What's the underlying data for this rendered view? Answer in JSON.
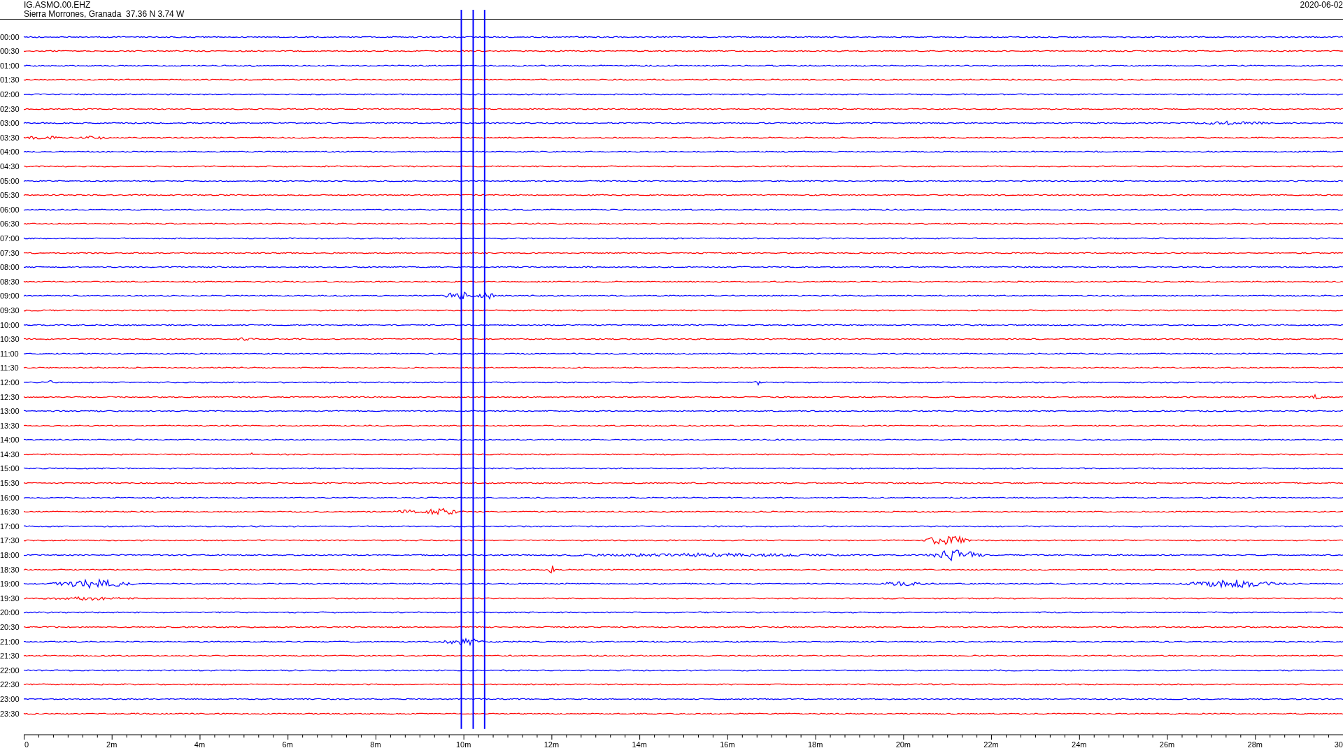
{
  "station": {
    "code": "IG.ASMO.00.EHZ",
    "location": "Sierra Morrones, Granada  37.36 N 3.74 W"
  },
  "date": "2020-06-02",
  "rows": [
    {
      "time": "00:00",
      "color": "#0000ff"
    },
    {
      "time": "00:30",
      "color": "#ff0000"
    },
    {
      "time": "01:00",
      "color": "#0000ff"
    },
    {
      "time": "01:30",
      "color": "#ff0000"
    },
    {
      "time": "02:00",
      "color": "#0000ff"
    },
    {
      "time": "02:30",
      "color": "#ff0000"
    },
    {
      "time": "03:00",
      "color": "#0000ff"
    },
    {
      "time": "03:30",
      "color": "#ff0000"
    },
    {
      "time": "04:00",
      "color": "#0000ff"
    },
    {
      "time": "04:30",
      "color": "#ff0000"
    },
    {
      "time": "05:00",
      "color": "#0000ff"
    },
    {
      "time": "05:30",
      "color": "#ff0000"
    },
    {
      "time": "06:00",
      "color": "#0000ff"
    },
    {
      "time": "06:30",
      "color": "#ff0000"
    },
    {
      "time": "07:00",
      "color": "#0000ff"
    },
    {
      "time": "07:30",
      "color": "#ff0000"
    },
    {
      "time": "08:00",
      "color": "#0000ff"
    },
    {
      "time": "08:30",
      "color": "#ff0000"
    },
    {
      "time": "09:00",
      "color": "#0000ff"
    },
    {
      "time": "09:30",
      "color": "#ff0000"
    },
    {
      "time": "10:00",
      "color": "#0000ff"
    },
    {
      "time": "10:30",
      "color": "#ff0000"
    },
    {
      "time": "11:00",
      "color": "#0000ff"
    },
    {
      "time": "11:30",
      "color": "#ff0000"
    },
    {
      "time": "12:00",
      "color": "#0000ff"
    },
    {
      "time": "12:30",
      "color": "#ff0000"
    },
    {
      "time": "13:00",
      "color": "#0000ff"
    },
    {
      "time": "13:30",
      "color": "#ff0000"
    },
    {
      "time": "14:00",
      "color": "#0000ff"
    },
    {
      "time": "14:30",
      "color": "#ff0000"
    },
    {
      "time": "15:00",
      "color": "#0000ff"
    },
    {
      "time": "15:30",
      "color": "#ff0000"
    },
    {
      "time": "16:00",
      "color": "#0000ff"
    },
    {
      "time": "16:30",
      "color": "#ff0000"
    },
    {
      "time": "17:00",
      "color": "#0000ff"
    },
    {
      "time": "17:30",
      "color": "#ff0000"
    },
    {
      "time": "18:00",
      "color": "#0000ff"
    },
    {
      "time": "18:30",
      "color": "#ff0000"
    },
    {
      "time": "19:00",
      "color": "#0000ff"
    },
    {
      "time": "19:30",
      "color": "#ff0000"
    },
    {
      "time": "20:00",
      "color": "#0000ff"
    },
    {
      "time": "20:30",
      "color": "#ff0000"
    },
    {
      "time": "21:00",
      "color": "#0000ff"
    },
    {
      "time": "21:30",
      "color": "#ff0000"
    },
    {
      "time": "22:00",
      "color": "#0000ff"
    },
    {
      "time": "22:30",
      "color": "#ff0000"
    },
    {
      "time": "23:00",
      "color": "#0000ff"
    },
    {
      "time": "23:30",
      "color": "#ff0000"
    }
  ],
  "x_axis": {
    "ticks": [
      "0",
      "2m",
      "4m",
      "6m",
      "8m",
      "10m",
      "12m",
      "14m",
      "16m",
      "18m",
      "20m",
      "22m",
      "24m",
      "26m",
      "28m",
      "30"
    ]
  }
}
